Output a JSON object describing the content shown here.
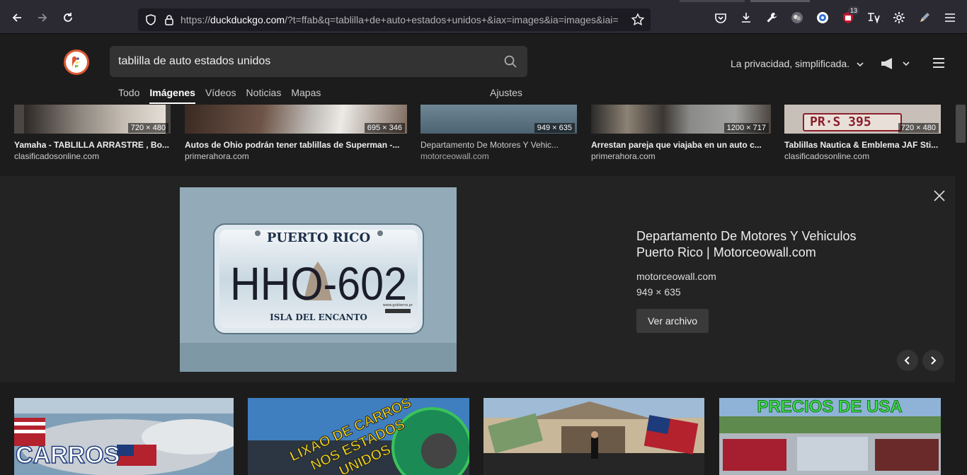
{
  "browser": {
    "url_domain": "duckduckgo.com",
    "url_prefix": "https://",
    "url_rest": "/?t=ffab&q=tablilla+de+auto+estados+unidos+&iax=images&ia=images&iai=",
    "extension_badge": "13"
  },
  "header": {
    "query": "tablilla de auto estados unidos",
    "privacy": "La privacidad, simplificada.",
    "tabs": [
      "Todo",
      "Imágenes",
      "Vídeos",
      "Noticias",
      "Mapas"
    ],
    "settings": "Ajustes"
  },
  "top_results": [
    {
      "dim": "720 × 480",
      "title": "Yamaha - TABLILLA ARRASTRE , Bo...",
      "source": "clasificadosonline.com"
    },
    {
      "dim": "695 × 346",
      "title": "Autos de Ohio podrán tener tablillas de Superman -...",
      "source": "primerahora.com"
    },
    {
      "dim": "949 × 635",
      "title": "Departamento De Motores Y Vehic...",
      "source": "motorceowall.com"
    },
    {
      "dim": "1200 × 717",
      "title": "Arrestan pareja que viajaba en un auto c...",
      "source": "primerahora.com"
    },
    {
      "dim": "720 × 480",
      "title": "Tablillas Nautica & Emblema JAF Sti...",
      "source": "clasificadosonline.com"
    }
  ],
  "detail": {
    "plate_top": "PUERTO RICO",
    "plate_number": "HHO-602",
    "plate_bottom": "ISLA DEL ENCANTO",
    "plate_site": "www.gobierno.pr",
    "title": "Departamento De Motores Y Vehiculos Puerto Rico | Motorceowall.com",
    "domain": "motorceowall.com",
    "size": "949 × 635",
    "button": "Ver archivo"
  },
  "bottom_results": {
    "t1_text": "CARROS",
    "t2_text_1": "LIXAO DE CARROS",
    "t2_text_2": "NOS ESTADOS",
    "t2_text_3": "UNIDOS",
    "t4_text": "PRECIOS DE USA"
  },
  "thumb_text": {
    "plate_snippet": "PR·S 395"
  }
}
